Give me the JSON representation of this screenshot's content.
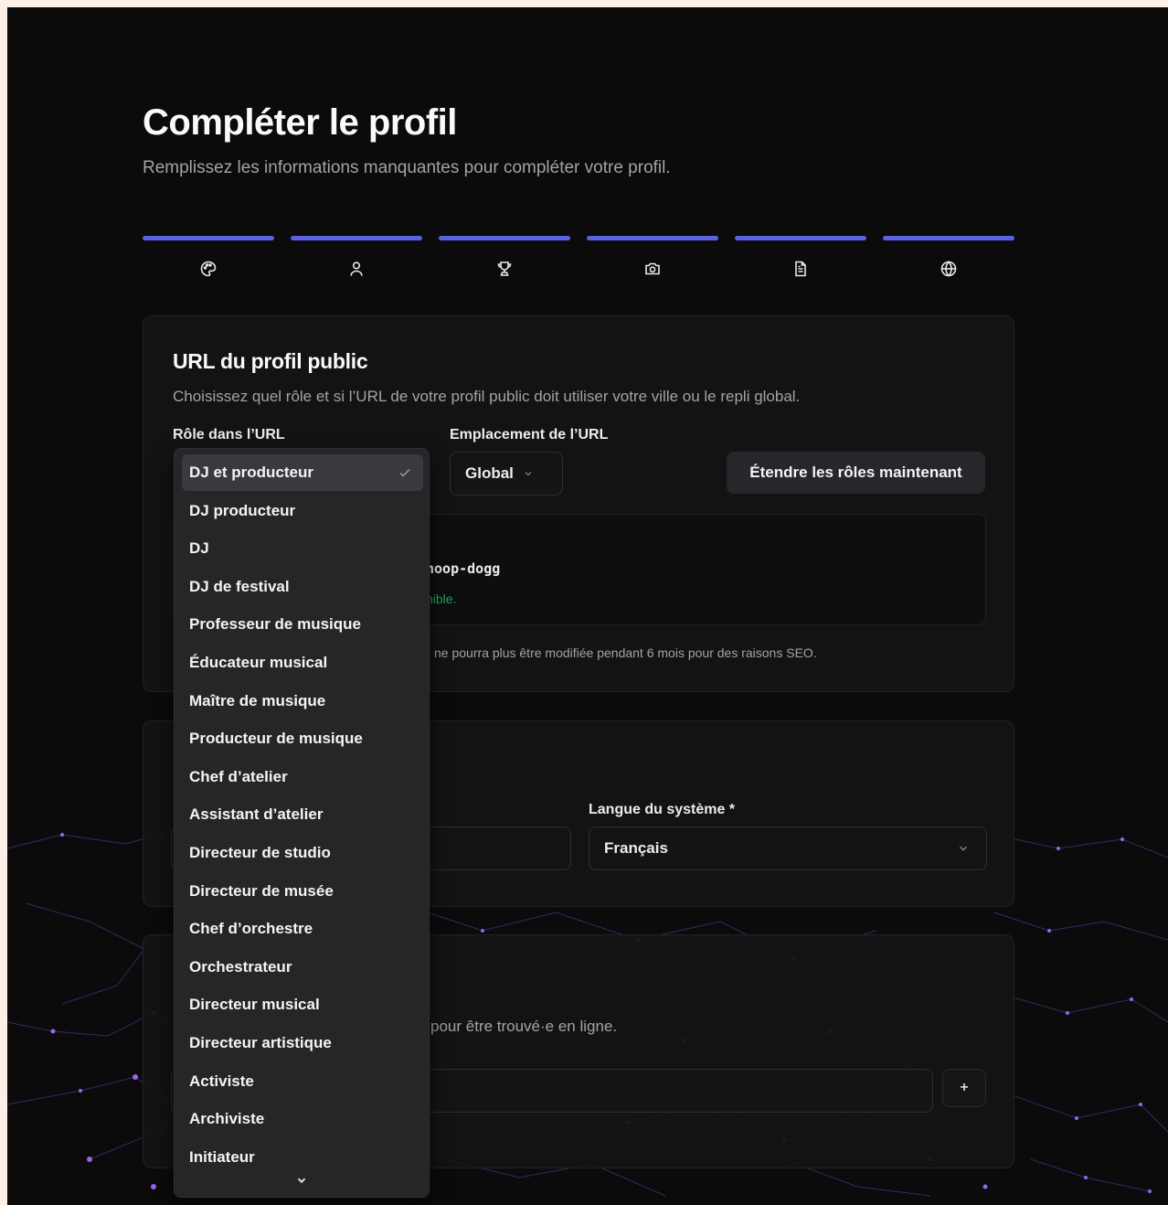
{
  "header": {
    "title": "Compléter le profil",
    "subtitle": "Remplissez les informations manquantes pour compléter votre profil."
  },
  "steps": [
    {
      "icon": "palette-icon",
      "completed": true
    },
    {
      "icon": "user-icon",
      "completed": true
    },
    {
      "icon": "trophy-icon",
      "completed": true
    },
    {
      "icon": "camera-icon",
      "completed": true
    },
    {
      "icon": "document-icon",
      "completed": true
    },
    {
      "icon": "globe-icon",
      "completed": true
    }
  ],
  "url_card": {
    "title": "URL du profil public",
    "description": "Choisissez quel rôle et si l’URL de votre profil public doit utiliser votre ville ou le repli global.",
    "role_label": "Rôle dans l’URL",
    "location_label": "Emplacement de l’URL",
    "location_value": "Global",
    "extend_button": "Étendre les rôles maintenant",
    "url_fragment": "noop-dogg",
    "availability_fragment": "nible.",
    "notice_fragment": "ne pourra plus être modifiée pendant 6 mois pour des raisons SEO."
  },
  "language_card": {
    "system_language_label": "Langue du système *",
    "system_language_value": "Français"
  },
  "search_card": {
    "description_fragment": "pour être trouvé·e en ligne.",
    "add_button": "+"
  },
  "role_dropdown": {
    "selected": "DJ et producteur",
    "options": [
      "DJ et producteur",
      "DJ producteur",
      "DJ",
      "DJ de festival",
      "Professeur de musique",
      "Éducateur musical",
      "Maître de musique",
      "Producteur de musique",
      "Chef d’atelier",
      "Assistant d’atelier",
      "Directeur de studio",
      "Directeur de musée",
      "Chef d’orchestre",
      "Orchestrateur",
      "Directeur musical",
      "Directeur artistique",
      "Activiste",
      "Archiviste",
      "Initiateur"
    ],
    "scroll_indicator": "chevron-down-icon"
  },
  "colors": {
    "accent": "#5a62e0",
    "background": "#0b0b0c",
    "success": "#22a55a",
    "network": "#8a4fd8"
  }
}
